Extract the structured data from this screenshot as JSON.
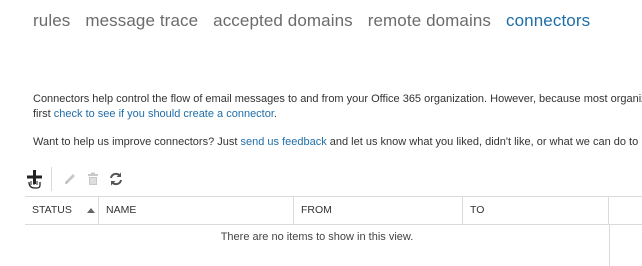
{
  "tabs": [
    {
      "label": "rules",
      "active": false
    },
    {
      "label": "message trace",
      "active": false
    },
    {
      "label": "accepted domains",
      "active": false
    },
    {
      "label": "remote domains",
      "active": false
    },
    {
      "label": "connectors",
      "active": true
    }
  ],
  "description": {
    "line1": "Connectors help control the flow of email messages to and from your Office 365 organization. However, because most organizat",
    "line2_prefix": "first ",
    "line2_link": "check to see if you should create a connector",
    "line2_suffix": "."
  },
  "feedback": {
    "prefix": "Want to help us improve connectors? Just ",
    "link": "send us feedback",
    "suffix": " and let us know what you liked, didn't like, or what we can do to ma"
  },
  "toolbar": {
    "icons": [
      "add-icon",
      "edit-icon",
      "delete-icon",
      "refresh-icon"
    ]
  },
  "grid": {
    "columns": [
      "STATUS",
      "NAME",
      "FROM",
      "TO"
    ],
    "sorted_column": "STATUS",
    "empty_message": "There are no items to show in this view."
  },
  "colors": {
    "accent": "#1f6ea8",
    "tab_inactive": "#6b6b6b",
    "border": "#dadada"
  }
}
